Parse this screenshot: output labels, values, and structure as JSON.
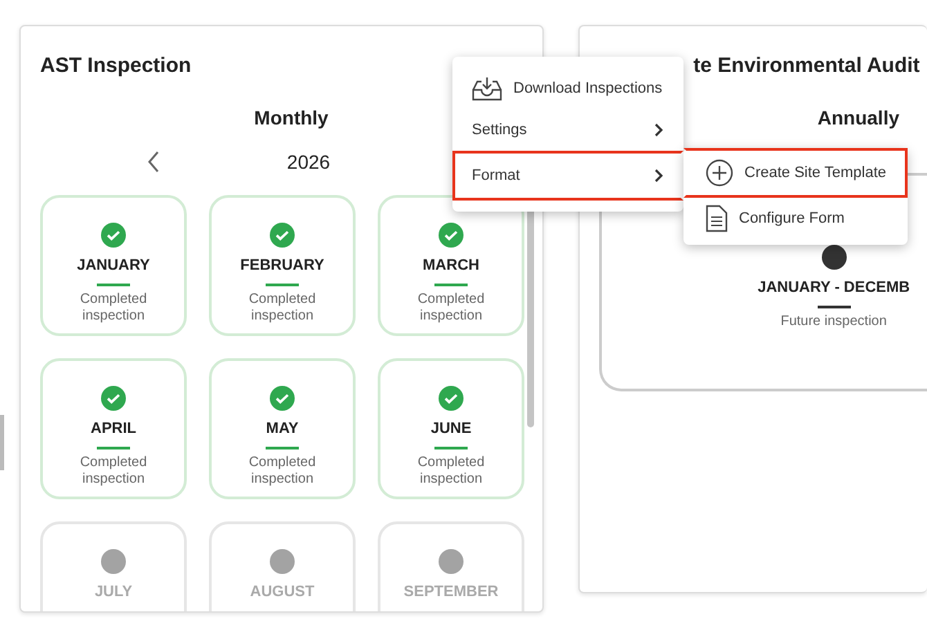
{
  "left_card": {
    "title": "AST Inspection",
    "frequency": "Monthly",
    "year": "2026",
    "months": [
      {
        "name": "JANUARY",
        "kind": "completed",
        "note": "Completed inspection"
      },
      {
        "name": "FEBRUARY",
        "kind": "completed",
        "note": "Completed inspection"
      },
      {
        "name": "MARCH",
        "kind": "completed",
        "note": "Completed inspection"
      },
      {
        "name": "APRIL",
        "kind": "completed",
        "note": "Completed inspection"
      },
      {
        "name": "MAY",
        "kind": "completed",
        "note": "Completed inspection"
      },
      {
        "name": "JUNE",
        "kind": "completed",
        "note": "Completed inspection"
      },
      {
        "name": "JULY",
        "kind": "pending"
      },
      {
        "name": "AUGUST",
        "kind": "pending"
      },
      {
        "name": "SEPTEMBER",
        "kind": "pending"
      }
    ]
  },
  "right_card": {
    "title": "te Environmental Audit",
    "frequency": "Annually",
    "period": {
      "name": "JANUARY - DECEMB",
      "kind": "future",
      "note": "Future inspection"
    }
  },
  "menu": {
    "items": [
      {
        "label": "Download Inspections",
        "kind": "download",
        "highlighted": false
      },
      {
        "label": "Settings",
        "kind": "submenu",
        "highlighted": false
      },
      {
        "label": "Format",
        "kind": "submenu",
        "highlighted": true
      }
    ]
  },
  "submenu": {
    "items": [
      {
        "label": "Create Site Template",
        "kind": "create",
        "highlighted": true
      },
      {
        "label": "Configure Form",
        "kind": "form",
        "highlighted": false
      }
    ]
  }
}
